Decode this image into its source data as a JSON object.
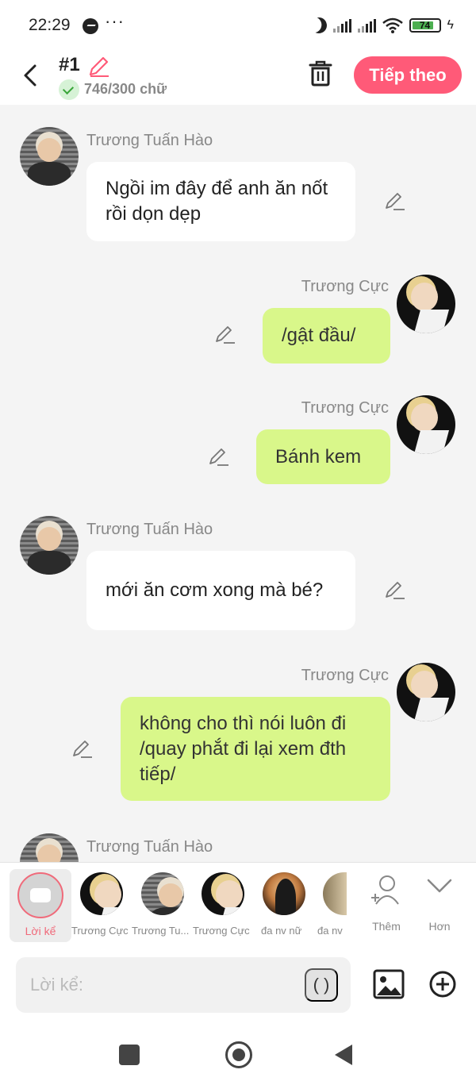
{
  "status_bar": {
    "time": "22:29",
    "dots": "···",
    "battery": "74",
    "icons": [
      "messenger-icon",
      "moon-icon",
      "signal-icon",
      "wifi-icon",
      "battery-icon",
      "charging-icon"
    ]
  },
  "header": {
    "title": "#1",
    "word_count": "746/300 chữ",
    "next_button": "Tiếp theo",
    "icons": [
      "back-arrow-icon",
      "pencil-icon",
      "check-icon",
      "trash-icon"
    ]
  },
  "messages": [
    {
      "side": "left",
      "speaker": "Trương Tuấn Hào",
      "text": "Ngồi im đây để anh ăn nốt rồi dọn dẹp"
    },
    {
      "side": "right",
      "speaker": "Trương Cực",
      "text": "/gật đầu/"
    },
    {
      "side": "right",
      "speaker": "Trương Cực",
      "text": "Bánh kem"
    },
    {
      "side": "left",
      "speaker": "Trương Tuấn Hào",
      "text": "mới ăn cơm xong mà bé?"
    },
    {
      "side": "right",
      "speaker": "Trương Cực",
      "text": "không cho thì nói luôn đi /quay phắt đi lại xem đth tiếp/"
    },
    {
      "side": "left",
      "speaker": "Trương Tuấn Hào",
      "text": ""
    }
  ],
  "characters": {
    "narrator": "Lời kể",
    "items": [
      "Trương Cực",
      "Trương Tu...",
      "Trương Cực",
      "đa nv nữ",
      "đa nv"
    ],
    "add": "Thêm",
    "more": "Hơn"
  },
  "input": {
    "placeholder": "Lời kể:",
    "paren_button": "( )",
    "icons": [
      "image-icon",
      "plus-circle-icon"
    ]
  },
  "nav": {
    "icons": [
      "recent-apps-icon",
      "home-icon",
      "back-icon"
    ]
  },
  "colors": {
    "accent": "#ff5a78",
    "bubble_right": "#d9f78a",
    "bubble_left": "#ffffff",
    "background": "#f4f4f4"
  }
}
